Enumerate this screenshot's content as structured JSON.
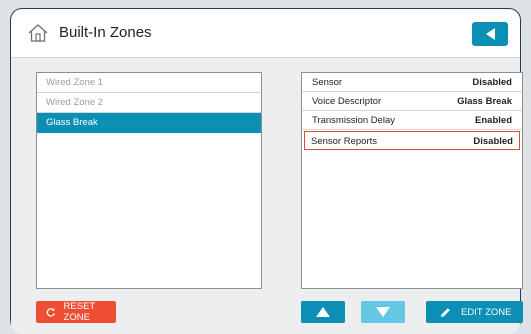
{
  "header": {
    "title": "Built-In Zones",
    "home_icon": "home-icon",
    "back_icon": "back-arrow-icon"
  },
  "zones": [
    {
      "label": "Wired Zone 1",
      "selected": false
    },
    {
      "label": "Wired Zone 2",
      "selected": false
    },
    {
      "label": "Glass Break",
      "selected": true
    }
  ],
  "properties": [
    {
      "label": "Sensor",
      "value": "Disabled",
      "highlighted": false
    },
    {
      "label": "Voice Descriptor",
      "value": "Glass Break",
      "highlighted": false
    },
    {
      "label": "Transmission Delay",
      "value": "Enabled",
      "highlighted": false
    },
    {
      "label": "Sensor Reports",
      "value": "Disabled",
      "highlighted": true
    }
  ],
  "buttons": {
    "reset_label": "RESET ZONE",
    "edit_label": "EDIT ZONE",
    "reset_icon": "reset-icon",
    "edit_icon": "pencil-icon",
    "up_icon": "arrow-up-icon",
    "down_icon": "arrow-down-icon"
  },
  "colors": {
    "accent": "#0c8fb5",
    "accent_light": "#64c8e3",
    "danger": "#ef4e35",
    "highlight_border": "#e14a32"
  }
}
